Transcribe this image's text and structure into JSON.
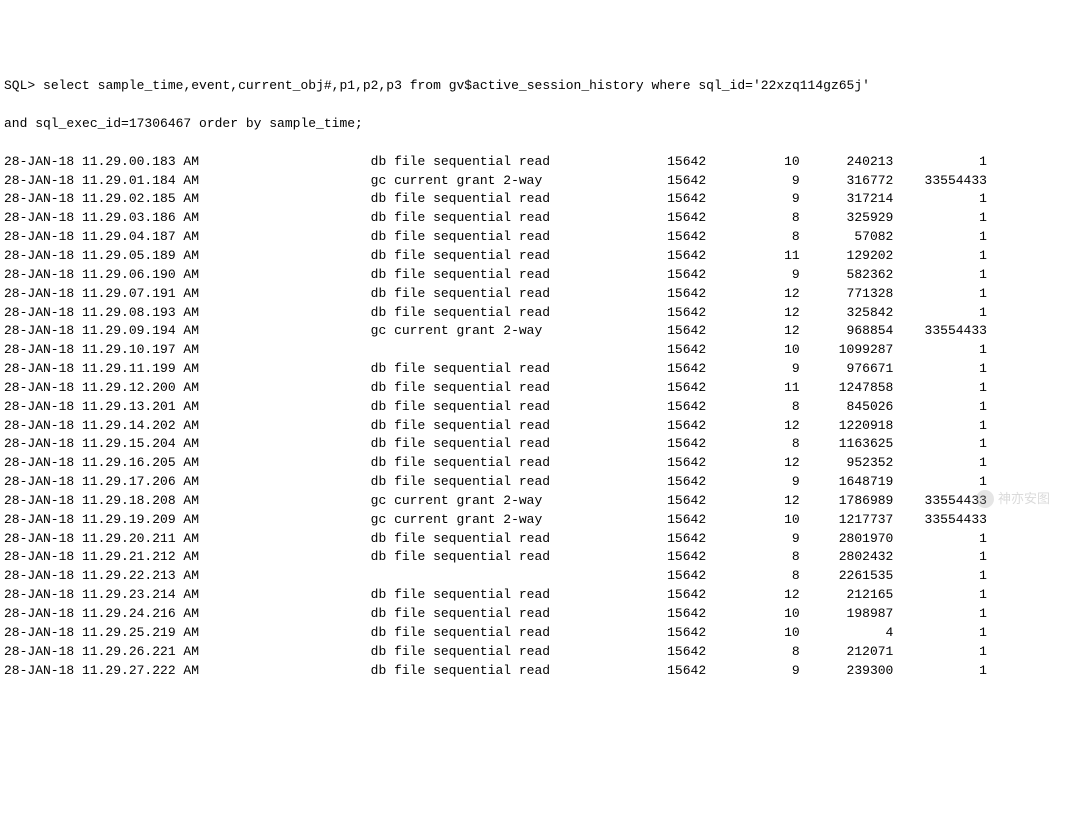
{
  "prompt": "SQL>",
  "query_line1": "select sample_time,event,current_obj#,p1,p2,p3 from gv$active_session_history where sql_id='22xzq114gz65j'",
  "query_line2": "and sql_exec_id=17306467 order by sample_time;",
  "rows": [
    {
      "sample_time": "28-JAN-18 11.29.00.183 AM",
      "event": "db file sequential read",
      "obj": "15642",
      "p1": "10",
      "p2": "240213",
      "p3": "1"
    },
    {
      "sample_time": "28-JAN-18 11.29.01.184 AM",
      "event": "gc current grant 2-way",
      "obj": "15642",
      "p1": "9",
      "p2": "316772",
      "p3": "33554433"
    },
    {
      "sample_time": "28-JAN-18 11.29.02.185 AM",
      "event": "db file sequential read",
      "obj": "15642",
      "p1": "9",
      "p2": "317214",
      "p3": "1"
    },
    {
      "sample_time": "28-JAN-18 11.29.03.186 AM",
      "event": "db file sequential read",
      "obj": "15642",
      "p1": "8",
      "p2": "325929",
      "p3": "1"
    },
    {
      "sample_time": "28-JAN-18 11.29.04.187 AM",
      "event": "db file sequential read",
      "obj": "15642",
      "p1": "8",
      "p2": "57082",
      "p3": "1"
    },
    {
      "sample_time": "28-JAN-18 11.29.05.189 AM",
      "event": "db file sequential read",
      "obj": "15642",
      "p1": "11",
      "p2": "129202",
      "p3": "1"
    },
    {
      "sample_time": "28-JAN-18 11.29.06.190 AM",
      "event": "db file sequential read",
      "obj": "15642",
      "p1": "9",
      "p2": "582362",
      "p3": "1"
    },
    {
      "sample_time": "28-JAN-18 11.29.07.191 AM",
      "event": "db file sequential read",
      "obj": "15642",
      "p1": "12",
      "p2": "771328",
      "p3": "1"
    },
    {
      "sample_time": "28-JAN-18 11.29.08.193 AM",
      "event": "db file sequential read",
      "obj": "15642",
      "p1": "12",
      "p2": "325842",
      "p3": "1"
    },
    {
      "sample_time": "28-JAN-18 11.29.09.194 AM",
      "event": "gc current grant 2-way",
      "obj": "15642",
      "p1": "12",
      "p2": "968854",
      "p3": "33554433"
    },
    {
      "sample_time": "28-JAN-18 11.29.10.197 AM",
      "event": "",
      "obj": "15642",
      "p1": "10",
      "p2": "1099287",
      "p3": "1"
    },
    {
      "sample_time": "28-JAN-18 11.29.11.199 AM",
      "event": "db file sequential read",
      "obj": "15642",
      "p1": "9",
      "p2": "976671",
      "p3": "1"
    },
    {
      "sample_time": "28-JAN-18 11.29.12.200 AM",
      "event": "db file sequential read",
      "obj": "15642",
      "p1": "11",
      "p2": "1247858",
      "p3": "1"
    },
    {
      "sample_time": "28-JAN-18 11.29.13.201 AM",
      "event": "db file sequential read",
      "obj": "15642",
      "p1": "8",
      "p2": "845026",
      "p3": "1"
    },
    {
      "sample_time": "28-JAN-18 11.29.14.202 AM",
      "event": "db file sequential read",
      "obj": "15642",
      "p1": "12",
      "p2": "1220918",
      "p3": "1"
    },
    {
      "sample_time": "28-JAN-18 11.29.15.204 AM",
      "event": "db file sequential read",
      "obj": "15642",
      "p1": "8",
      "p2": "1163625",
      "p3": "1"
    },
    {
      "sample_time": "28-JAN-18 11.29.16.205 AM",
      "event": "db file sequential read",
      "obj": "15642",
      "p1": "12",
      "p2": "952352",
      "p3": "1"
    },
    {
      "sample_time": "28-JAN-18 11.29.17.206 AM",
      "event": "db file sequential read",
      "obj": "15642",
      "p1": "9",
      "p2": "1648719",
      "p3": "1"
    },
    {
      "sample_time": "28-JAN-18 11.29.18.208 AM",
      "event": "gc current grant 2-way",
      "obj": "15642",
      "p1": "12",
      "p2": "1786989",
      "p3": "33554433"
    },
    {
      "sample_time": "28-JAN-18 11.29.19.209 AM",
      "event": "gc current grant 2-way",
      "obj": "15642",
      "p1": "10",
      "p2": "1217737",
      "p3": "33554433"
    },
    {
      "sample_time": "28-JAN-18 11.29.20.211 AM",
      "event": "db file sequential read",
      "obj": "15642",
      "p1": "9",
      "p2": "2801970",
      "p3": "1"
    },
    {
      "sample_time": "28-JAN-18 11.29.21.212 AM",
      "event": "db file sequential read",
      "obj": "15642",
      "p1": "8",
      "p2": "2802432",
      "p3": "1"
    },
    {
      "sample_time": "28-JAN-18 11.29.22.213 AM",
      "event": "",
      "obj": "15642",
      "p1": "8",
      "p2": "2261535",
      "p3": "1"
    },
    {
      "sample_time": "28-JAN-18 11.29.23.214 AM",
      "event": "db file sequential read",
      "obj": "15642",
      "p1": "12",
      "p2": "212165",
      "p3": "1"
    },
    {
      "sample_time": "28-JAN-18 11.29.24.216 AM",
      "event": "db file sequential read",
      "obj": "15642",
      "p1": "10",
      "p2": "198987",
      "p3": "1"
    },
    {
      "sample_time": "28-JAN-18 11.29.25.219 AM",
      "event": "db file sequential read",
      "obj": "15642",
      "p1": "10",
      "p2": "4",
      "p3": "1"
    },
    {
      "sample_time": "28-JAN-18 11.29.26.221 AM",
      "event": "db file sequential read",
      "obj": "15642",
      "p1": "8",
      "p2": "212071",
      "p3": "1"
    },
    {
      "sample_time": "28-JAN-18 11.29.27.222 AM",
      "event": "db file sequential read",
      "obj": "15642",
      "p1": "9",
      "p2": "239300",
      "p3": "1"
    }
  ],
  "watermark_text": "神亦安图",
  "col_widths": {
    "sample_time": 47,
    "event": 33,
    "obj": 10,
    "p1": 12,
    "p2": 12,
    "p3": 12
  }
}
